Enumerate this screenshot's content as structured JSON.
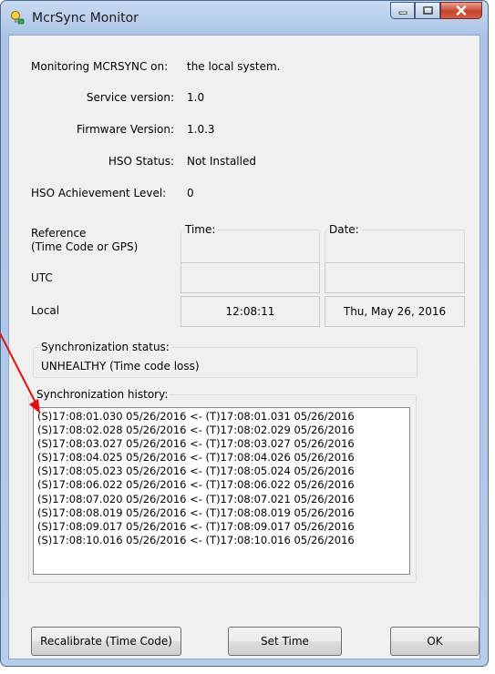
{
  "window": {
    "title": "McrSync Monitor"
  },
  "info": [
    {
      "label": "Monitoring MCRSYNC on:",
      "value": "the local system."
    },
    {
      "label": "Service version:",
      "value": "1.0"
    },
    {
      "label": "Firmware Version:",
      "value": "1.0.3"
    },
    {
      "label": "HSO Status:",
      "value": "Not Installed"
    },
    {
      "label": "HSO Achievement Level:",
      "value": "0"
    }
  ],
  "time_table": {
    "time_header": "Time:",
    "date_header": "Date:",
    "reference_label": "Reference",
    "reference_sub": "(Time Code or GPS)",
    "utc_label": "UTC",
    "local_label": "Local",
    "local_time": "12:08:11",
    "local_date": "Thu, May 26, 2016"
  },
  "sync_status": {
    "legend": "Synchronization status:",
    "value": "UNHEALTHY (Time code loss)"
  },
  "sync_history": {
    "legend": "Synchronization history:",
    "lines": [
      "(S)17:08:01.030 05/26/2016 <- (T)17:08:01.031 05/26/2016",
      "(S)17:08:02.028 05/26/2016 <- (T)17:08:02.029 05/26/2016",
      "(S)17:08:03.027 05/26/2016 <- (T)17:08:03.027 05/26/2016",
      "(S)17:08:04.025 05/26/2016 <- (T)17:08:04.026 05/26/2016",
      "(S)17:08:05.023 05/26/2016 <- (T)17:08:05.024 05/26/2016",
      "(S)17:08:06.022 05/26/2016 <- (T)17:08:06.022 05/26/2016",
      "(S)17:08:07.020 05/26/2016 <- (T)17:08:07.021 05/26/2016",
      "(S)17:08:08.019 05/26/2016 <- (T)17:08:08.019 05/26/2016",
      "(S)17:08:09.017 05/26/2016 <- (T)17:08:09.017 05/26/2016",
      "(S)17:08:10.016 05/26/2016 <- (T)17:08:10.016 05/26/2016"
    ]
  },
  "buttons": {
    "recalibrate": "Recalibrate (Time Code)",
    "set_time": "Set Time",
    "ok": "OK"
  },
  "icons": {
    "app": "mcrsync-app-icon",
    "minimize": "minimize-icon",
    "maximize": "maximize-icon",
    "close": "close-icon",
    "annotation": "red-arrow-annotation"
  },
  "colors": {
    "close_button": "#c8432b",
    "annotation_arrow": "#e01010"
  }
}
